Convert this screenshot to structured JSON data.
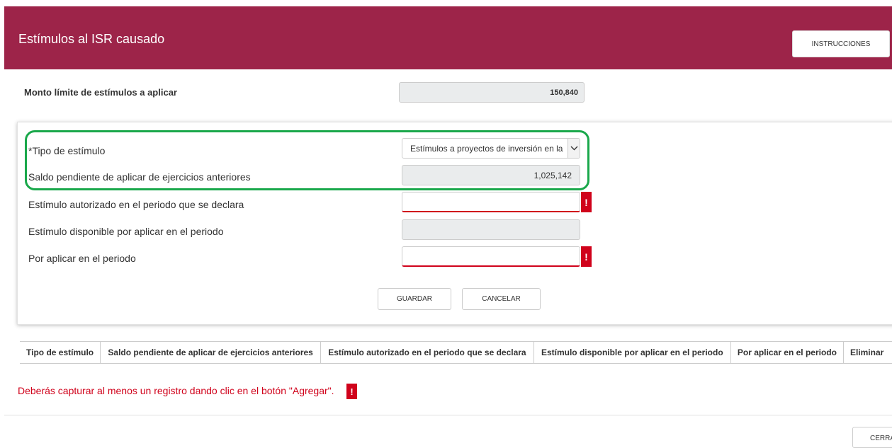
{
  "header": {
    "title": "Estímulos al ISR causado",
    "instructions_button": "INSTRUCCIONES",
    "color": "#9d2449"
  },
  "limit": {
    "label": "Monto límite de estímulos a aplicar",
    "value": "150,840"
  },
  "form": {
    "tipo_label": "*Tipo de estímulo",
    "tipo_value": "Estímulos a proyectos de inversión en la",
    "saldo_label": "Saldo pendiente de aplicar de ejercicios anteriores",
    "saldo_value": "1,025,142",
    "autorizado_label": "Estímulo autorizado en el periodo que se declara",
    "autorizado_value": "",
    "disponible_label": "Estímulo disponible por aplicar en el periodo",
    "disponible_value": "",
    "por_aplicar_label": "Por aplicar en el periodo",
    "por_aplicar_value": "",
    "error_mark": "!",
    "save_button": "GUARDAR",
    "cancel_button": "CANCELAR"
  },
  "table": {
    "columns": [
      "Tipo de estímulo",
      "Saldo pendiente de aplicar de ejercicios anteriores",
      "Estímulo autorizado en el periodo que se declara",
      "Estímulo disponible por aplicar en el periodo",
      "Por aplicar en el periodo",
      "Eliminar"
    ]
  },
  "message": {
    "text": "Deberás capturar al menos un registro dando clic en el botón \"Agregar\".",
    "error_mark": "!"
  },
  "footer": {
    "close_button": "CERRAR"
  },
  "colors": {
    "accent": "#9d2449",
    "error": "#d0021b",
    "highlight": "#1aa84b"
  }
}
